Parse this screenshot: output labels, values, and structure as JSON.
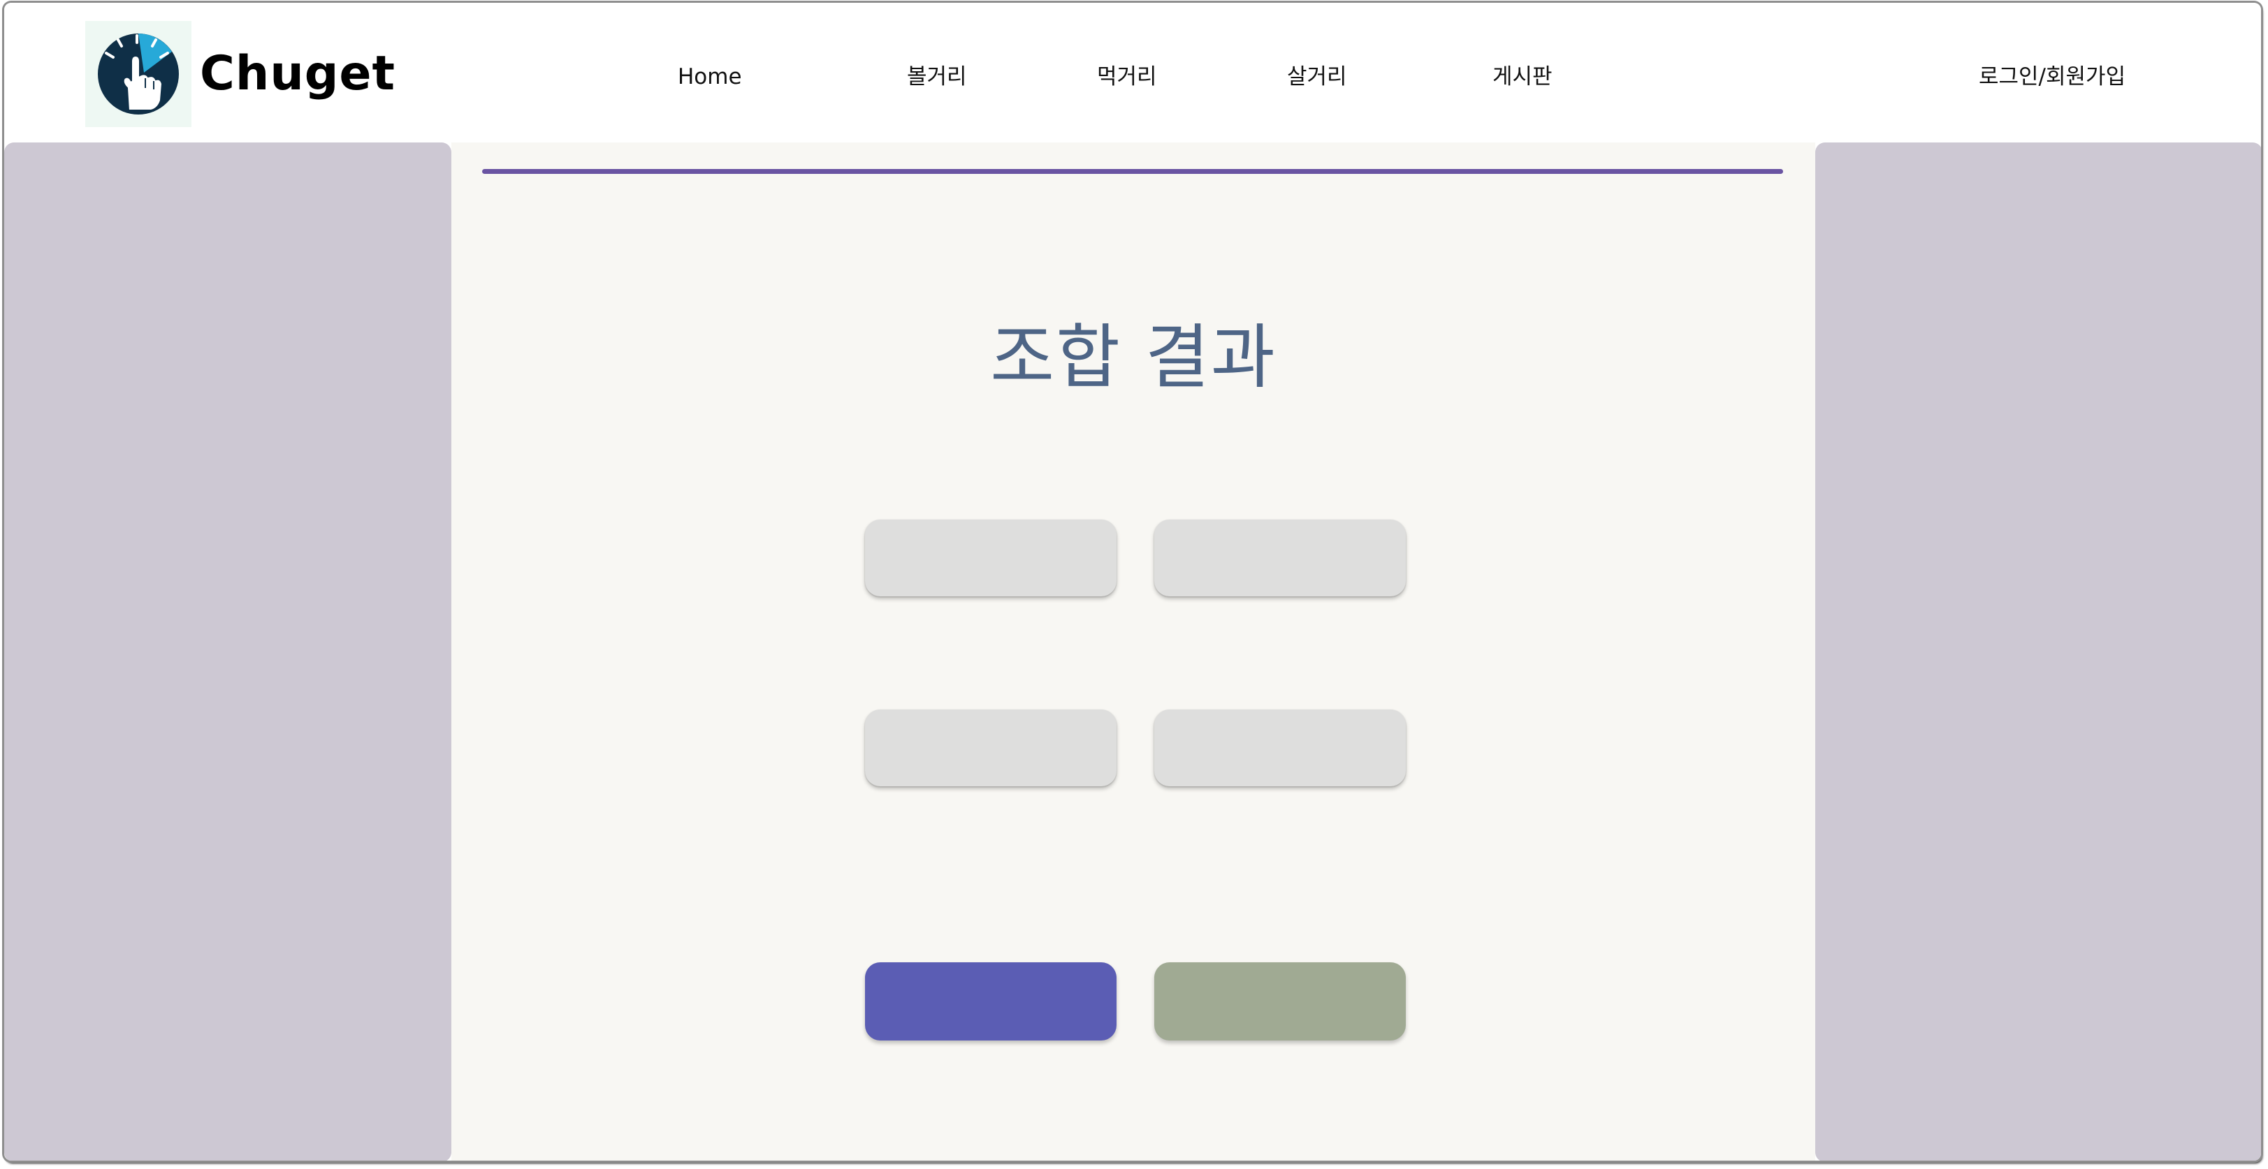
{
  "header": {
    "brand": "Chuget",
    "nav": [
      {
        "label": "Home"
      },
      {
        "label": "볼거리"
      },
      {
        "label": "먹거리"
      },
      {
        "label": "살거리"
      },
      {
        "label": "게시판"
      }
    ],
    "login_label": "로그인/회원가입"
  },
  "main": {
    "title": "조합 결과",
    "result_slots": [
      "",
      "",
      "",
      ""
    ],
    "buttons": {
      "primary_label": "",
      "secondary_label": ""
    }
  },
  "colors": {
    "accent_purple": "#6a54a2",
    "title_blue": "#4e6586",
    "side_panel": "#cdc8d3",
    "main_bg": "#f8f7f3",
    "slot_gray": "#dededd",
    "primary_button": "#5b5db4",
    "secondary_button": "#a0aa93",
    "logo_circle": "#0f2f47",
    "logo_cyan": "#27a9d8"
  },
  "icons": {
    "logo": "pointing-hand-click-icon"
  }
}
